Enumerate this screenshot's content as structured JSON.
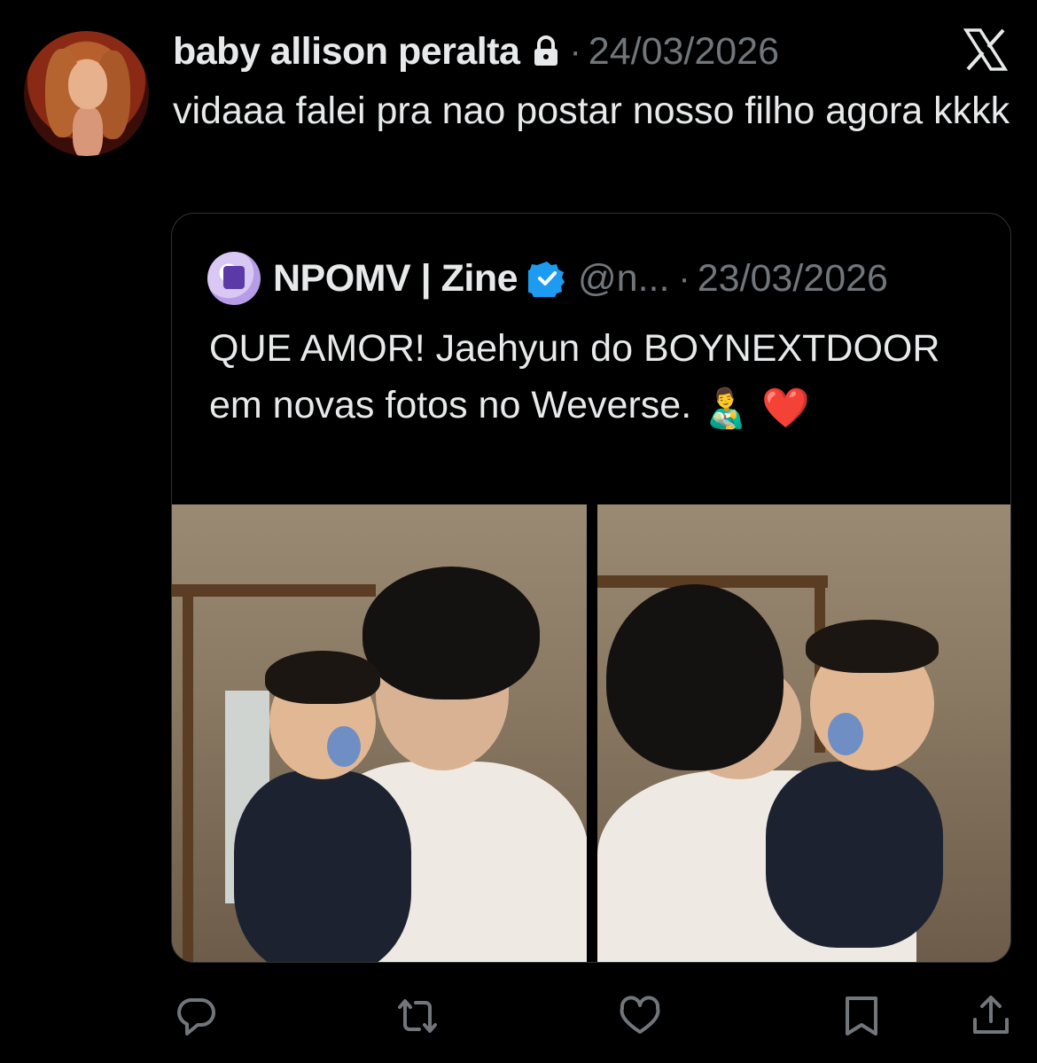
{
  "tweet": {
    "author_name": "baby allison peralta",
    "separator": "·",
    "date": "24/03/2026",
    "text": "vidaaa falei pra nao postar nosso filho agora kkkk"
  },
  "quote": {
    "author_name": "NPOMV | Zine",
    "handle": "@n...",
    "separator": "·",
    "date": "23/03/2026",
    "text": "QUE AMOR! Jaehyun do BOYNEXTDOOR em novas fotos no Weverse.",
    "emojis": "👨‍🍼 ❤️"
  },
  "icons": {
    "header": [
      "lock-icon",
      "x-logo-icon"
    ],
    "quote": [
      "verified-badge-icon"
    ],
    "actions": [
      "reply-icon",
      "retweet-icon",
      "like-icon",
      "bookmark-icon",
      "share-icon"
    ]
  },
  "colors": {
    "background": "#000000",
    "text": "#e7e9ea",
    "muted": "#71767b",
    "verified": "#1d9bf0",
    "border": "#2f3336"
  }
}
